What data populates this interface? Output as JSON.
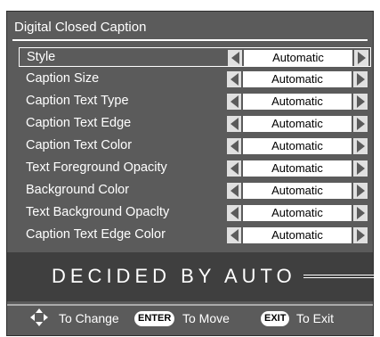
{
  "title": "Digital Closed Caption",
  "rows": [
    {
      "label": "Style",
      "value": "Automatic"
    },
    {
      "label": "Caption Size",
      "value": "Automatic"
    },
    {
      "label": "Caption Text Type",
      "value": "Automatic"
    },
    {
      "label": "Caption Text Edge",
      "value": "Automatic"
    },
    {
      "label": "Caption Text Color",
      "value": "Automatic"
    },
    {
      "label": "Text Foreground Opacity",
      "value": "Automatic"
    },
    {
      "label": "Background Color",
      "value": "Automatic"
    },
    {
      "label": "Text Background Opaclty",
      "value": "Automatic"
    },
    {
      "label": "Caption Text Edge Color",
      "value": "Automatic"
    }
  ],
  "description": "DECIDED BY AUTO",
  "hints": {
    "change": "To Change",
    "enter_key": "ENTER",
    "move": "To Move",
    "exit_key": "EXIT",
    "exit": "To Exit"
  },
  "icons": {
    "dpad": "dpad-icon",
    "left": "arrow-left-icon",
    "right": "arrow-right-icon"
  },
  "colors": {
    "panel": "#5b5b5b",
    "desc_bg": "#3f3f3f",
    "text": "#ffffff"
  }
}
